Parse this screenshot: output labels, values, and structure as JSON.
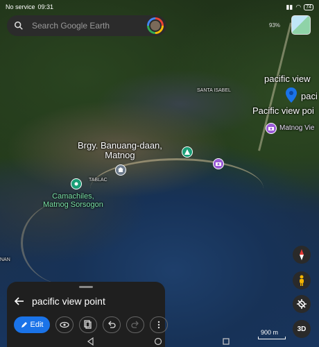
{
  "status": {
    "carrier": "No service",
    "time": "09:31",
    "battery": "74"
  },
  "search": {
    "placeholder": "Search Google Earth"
  },
  "map": {
    "compass_text": "93%",
    "labels": {
      "pacific_view_top": "pacific view",
      "pacific_view_clip": "paci",
      "pacific_view_point": "Pacific view poi",
      "matnog_view": "Matnog Vie",
      "santa_isabel": "SANTA ISABEL",
      "banuang_line1": "Brgy. Banuang-daan,",
      "banuang_line2": "Matnog",
      "tablac": "TABLAC",
      "camachiles_line1": "Camachiles,",
      "camachiles_line2": "Matnog Sorsogon",
      "nan": "NAN"
    },
    "scale_label": "900 m",
    "view_3d_label": "3D"
  },
  "sheet": {
    "title": "pacific view point",
    "edit_label": "Edit"
  },
  "colors": {
    "accent": "#1a73e8",
    "sheet_bg": "#1f1f1f",
    "green_label": "#7be3a8"
  }
}
